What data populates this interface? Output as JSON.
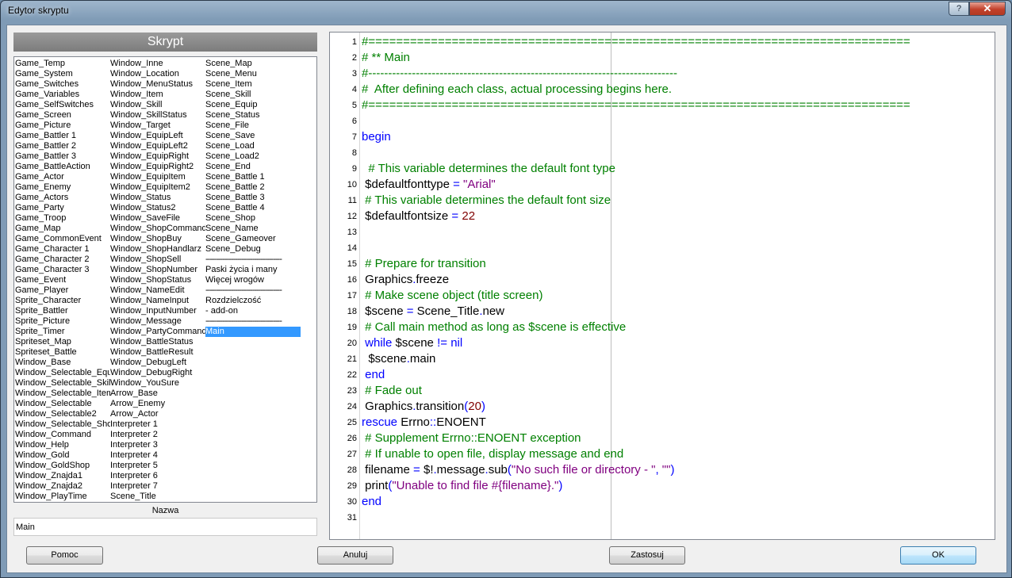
{
  "window": {
    "title": "Edytor skryptu"
  },
  "titlebar": {
    "help_glyph": "?",
    "close_glyph": "✕"
  },
  "sidebar": {
    "header": "Skrypt",
    "columns": [
      [
        "Game_Temp",
        "Game_System",
        "Game_Switches",
        "Game_Variables",
        "Game_SelfSwitches",
        "Game_Screen",
        "Game_Picture",
        "Game_Battler 1",
        "Game_Battler 2",
        "Game_Battler 3",
        "Game_BattleAction",
        "Game_Actor",
        "Game_Enemy",
        "Game_Actors",
        "Game_Party",
        "Game_Troop",
        "Game_Map",
        "Game_CommonEvent",
        "Game_Character 1",
        "Game_Character 2",
        "Game_Character 3",
        "Game_Event",
        "Game_Player",
        "Sprite_Character",
        "Sprite_Battler",
        "Sprite_Picture",
        "Sprite_Timer",
        "Spriteset_Map",
        "Spriteset_Battle",
        "Window_Base",
        "Window_Selectable_Equ",
        "Window_Selectable_Skill",
        "Window_Selectable_Item",
        "Window_Selectable",
        "Window_Selectable2",
        "Window_Selectable_Sho",
        "Window_Command",
        "Window_Help",
        "Window_Gold",
        "Window_GoldShop",
        "Window_Znajda1",
        "Window_Znajda2",
        "Window_PlayTime"
      ],
      [
        "Window_Inne",
        "Window_Location",
        "Window_MenuStatus",
        "Window_Item",
        "Window_Skill",
        "Window_SkillStatus",
        "Window_Target",
        "Window_EquipLeft",
        "Window_EquipLeft2",
        "Window_EquipRight",
        "Window_EquipRight2",
        "Window_EquipItem",
        "Window_EquipItem2",
        "Window_Status",
        "Window_Status2",
        "Window_SaveFile",
        "Window_ShopCommand",
        "Window_ShopBuy",
        "Window_ShopHandlarz",
        "Window_ShopSell",
        "Window_ShopNumber",
        "Window_ShopStatus",
        "Window_NameEdit",
        "Window_NameInput",
        "Window_InputNumber",
        "Window_Message",
        "Window_PartyCommand",
        "Window_BattleStatus",
        "Window_BattleResult",
        "Window_DebugLeft",
        "Window_DebugRight",
        "Window_YouSure",
        "Arrow_Base",
        "Arrow_Enemy",
        "Arrow_Actor",
        "Interpreter 1",
        "Interpreter 2",
        "Interpreter 3",
        "Interpreter 4",
        "Interpreter 5",
        "Interpreter 6",
        "Interpreter 7",
        "Scene_Title"
      ],
      [
        "Scene_Map",
        "Scene_Menu",
        "Scene_Item",
        "Scene_Skill",
        "Scene_Equip",
        "Scene_Status",
        "Scene_File",
        "Scene_Save",
        "Scene_Load",
        "Scene_Load2",
        "Scene_End",
        "Scene_Battle 1",
        "Scene_Battle 2",
        "Scene_Battle 3",
        "Scene_Battle 4",
        "Scene_Shop",
        "Scene_Name",
        "Scene_Gameover",
        "Scene_Debug",
        "------------------------------------",
        "Paski życia i many",
        "Więcej wrogów",
        "------------------------------------",
        "Rozdzielczość",
        "      - add-on",
        "------------------------------------",
        "Main"
      ]
    ],
    "selected": "Main"
  },
  "name_field": {
    "label": "Nazwa",
    "value": "Main"
  },
  "editor": {
    "lines": [
      [
        [
          "cm",
          "#=============================================================================="
        ]
      ],
      [
        [
          "cm",
          "# ** Main"
        ]
      ],
      [
        [
          "cm",
          "#------------------------------------------------------------------------------"
        ]
      ],
      [
        [
          "cm",
          "#  After defining each class, actual processing begins here."
        ]
      ],
      [
        [
          "cm",
          "#=============================================================================="
        ]
      ],
      [],
      [
        [
          "kw",
          "begin"
        ]
      ],
      [],
      [
        [
          "cm",
          "  # This variable determines the default font type"
        ]
      ],
      [
        [
          "cn",
          " $defaultfonttype "
        ],
        [
          "op",
          "="
        ],
        [
          "cn",
          " "
        ],
        [
          "str",
          "\"Arial\""
        ]
      ],
      [
        [
          "cm",
          " # This variable determines the default font size"
        ]
      ],
      [
        [
          "cn",
          " $defaultfontsize "
        ],
        [
          "op",
          "="
        ],
        [
          "cn",
          " "
        ],
        [
          "num",
          "22"
        ]
      ],
      [],
      [],
      [
        [
          "cm",
          " # Prepare for transition"
        ]
      ],
      [
        [
          "cn",
          " Graphics"
        ],
        [
          "op",
          "."
        ],
        [
          "cn",
          "freeze"
        ]
      ],
      [
        [
          "cm",
          " # Make scene object (title screen)"
        ]
      ],
      [
        [
          "cn",
          " $scene "
        ],
        [
          "op",
          "="
        ],
        [
          "cn",
          " Scene_Title"
        ],
        [
          "op",
          "."
        ],
        [
          "cn",
          "new"
        ]
      ],
      [
        [
          "cm",
          " # Call main method as long as $scene is effective"
        ]
      ],
      [
        [
          "kw",
          " while"
        ],
        [
          "cn",
          " $scene "
        ],
        [
          "op",
          "!="
        ],
        [
          "cn",
          " "
        ],
        [
          "kw",
          "nil"
        ]
      ],
      [
        [
          "cn",
          "  $scene"
        ],
        [
          "op",
          "."
        ],
        [
          "cn",
          "main"
        ]
      ],
      [
        [
          "kw",
          " end"
        ]
      ],
      [
        [
          "cm",
          " # Fade out"
        ]
      ],
      [
        [
          "cn",
          " Graphics"
        ],
        [
          "op",
          "."
        ],
        [
          "cn",
          "transition"
        ],
        [
          "op",
          "("
        ],
        [
          "num",
          "20"
        ],
        [
          "op",
          ")"
        ]
      ],
      [
        [
          "kw",
          "rescue"
        ],
        [
          "cn",
          " Errno"
        ],
        [
          "op",
          "::"
        ],
        [
          "cn",
          "ENOENT"
        ]
      ],
      [
        [
          "cm",
          " # Supplement Errno::ENOENT exception"
        ]
      ],
      [
        [
          "cm",
          " # If unable to open file, display message and end"
        ]
      ],
      [
        [
          "cn",
          " filename "
        ],
        [
          "op",
          "="
        ],
        [
          "cn",
          " $!"
        ],
        [
          "op",
          "."
        ],
        [
          "cn",
          "message"
        ],
        [
          "op",
          "."
        ],
        [
          "cn",
          "sub"
        ],
        [
          "op",
          "("
        ],
        [
          "str",
          "\"No such file or directory - \""
        ],
        [
          "op",
          ","
        ],
        [
          "cn",
          " "
        ],
        [
          "str",
          "\"\""
        ],
        [
          "op",
          ")"
        ]
      ],
      [
        [
          "cn",
          " print"
        ],
        [
          "op",
          "("
        ],
        [
          "str",
          "\"Unable to find file #{filename}.\""
        ],
        [
          "op",
          ")"
        ]
      ],
      [
        [
          "kw",
          "end"
        ]
      ],
      []
    ]
  },
  "buttons": {
    "help": "Pomoc",
    "cancel": "Anuluj",
    "apply": "Zastosuj",
    "ok": "OK"
  },
  "colors": {
    "comment": "#008000",
    "keyword": "#0000ff",
    "string": "#800080",
    "number": "#800000",
    "selection": "#3399ff"
  }
}
